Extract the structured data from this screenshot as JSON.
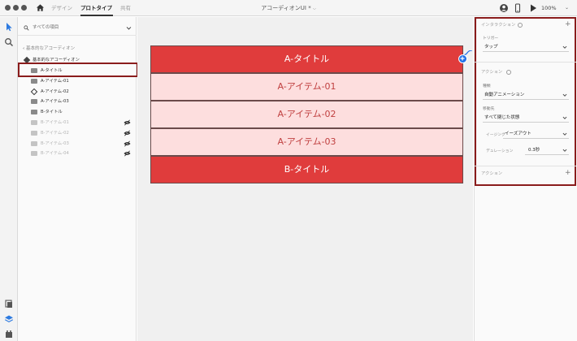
{
  "titlebar": {
    "tabs": {
      "design": "デザイン",
      "prototype": "プロトタイプ",
      "share": "共有"
    },
    "document_title": "アコーディオンUI *",
    "zoom": "100%"
  },
  "icons": {
    "home": "home-icon",
    "user": "user-icon",
    "device": "mobile-device-icon",
    "play": "play-icon",
    "select_tool": "select-arrow-icon",
    "zoom_tool": "magnifier-icon",
    "assets": "assets-icon",
    "layers": "layers-icon",
    "plugins": "plugins-icon"
  },
  "layers_panel": {
    "search_label": "すべての項目",
    "back_label": "基本的なアコーディオン",
    "group_label": "基本的なアコーディオン",
    "items": [
      {
        "label": "A-タイトル",
        "type": "folder",
        "dim": false,
        "hidden": false
      },
      {
        "label": "A-アイテム-01",
        "type": "folder",
        "dim": false,
        "hidden": false
      },
      {
        "label": "A-アイテム-02",
        "type": "component",
        "dim": false,
        "hidden": false
      },
      {
        "label": "A-アイテム-03",
        "type": "folder",
        "dim": false,
        "hidden": false
      },
      {
        "label": "B-タイトル",
        "type": "folder",
        "dim": false,
        "hidden": false
      },
      {
        "label": "B-アイテム-01",
        "type": "folder",
        "dim": true,
        "hidden": true
      },
      {
        "label": "B-アイテム-02",
        "type": "folder",
        "dim": true,
        "hidden": true
      },
      {
        "label": "B-アイテム-03",
        "type": "folder",
        "dim": true,
        "hidden": true
      },
      {
        "label": "B-アイテム-04",
        "type": "folder",
        "dim": true,
        "hidden": true
      }
    ]
  },
  "canvas": {
    "rows": [
      {
        "label": "A-タイトル",
        "kind": "title"
      },
      {
        "label": "A-アイテム-01",
        "kind": "item"
      },
      {
        "label": "A-アイテム-02",
        "kind": "item"
      },
      {
        "label": "A-アイテム-03",
        "kind": "item"
      },
      {
        "label": "B-タイトル",
        "kind": "title"
      }
    ],
    "colors": {
      "title_bg": "#e03c3c",
      "item_bg": "#fddede",
      "item_text": "#c04040",
      "flow_handle": "#1e6fe8"
    }
  },
  "props_panel": {
    "interaction_title": "インタラクション",
    "trigger_label": "トリガー",
    "trigger_value": "タップ",
    "action_title": "アクション",
    "type_label": "種類",
    "type_value": "自動アニメーション",
    "destination_label": "移動先",
    "destination_value": "すべて閉じた状態",
    "easing_label": "イージング",
    "easing_value": "イーズアウト",
    "duration_label": "デュレーション",
    "duration_value": "0.3秒",
    "footer_action_title": "アクション",
    "highlight_color": "#8a1c1c"
  }
}
